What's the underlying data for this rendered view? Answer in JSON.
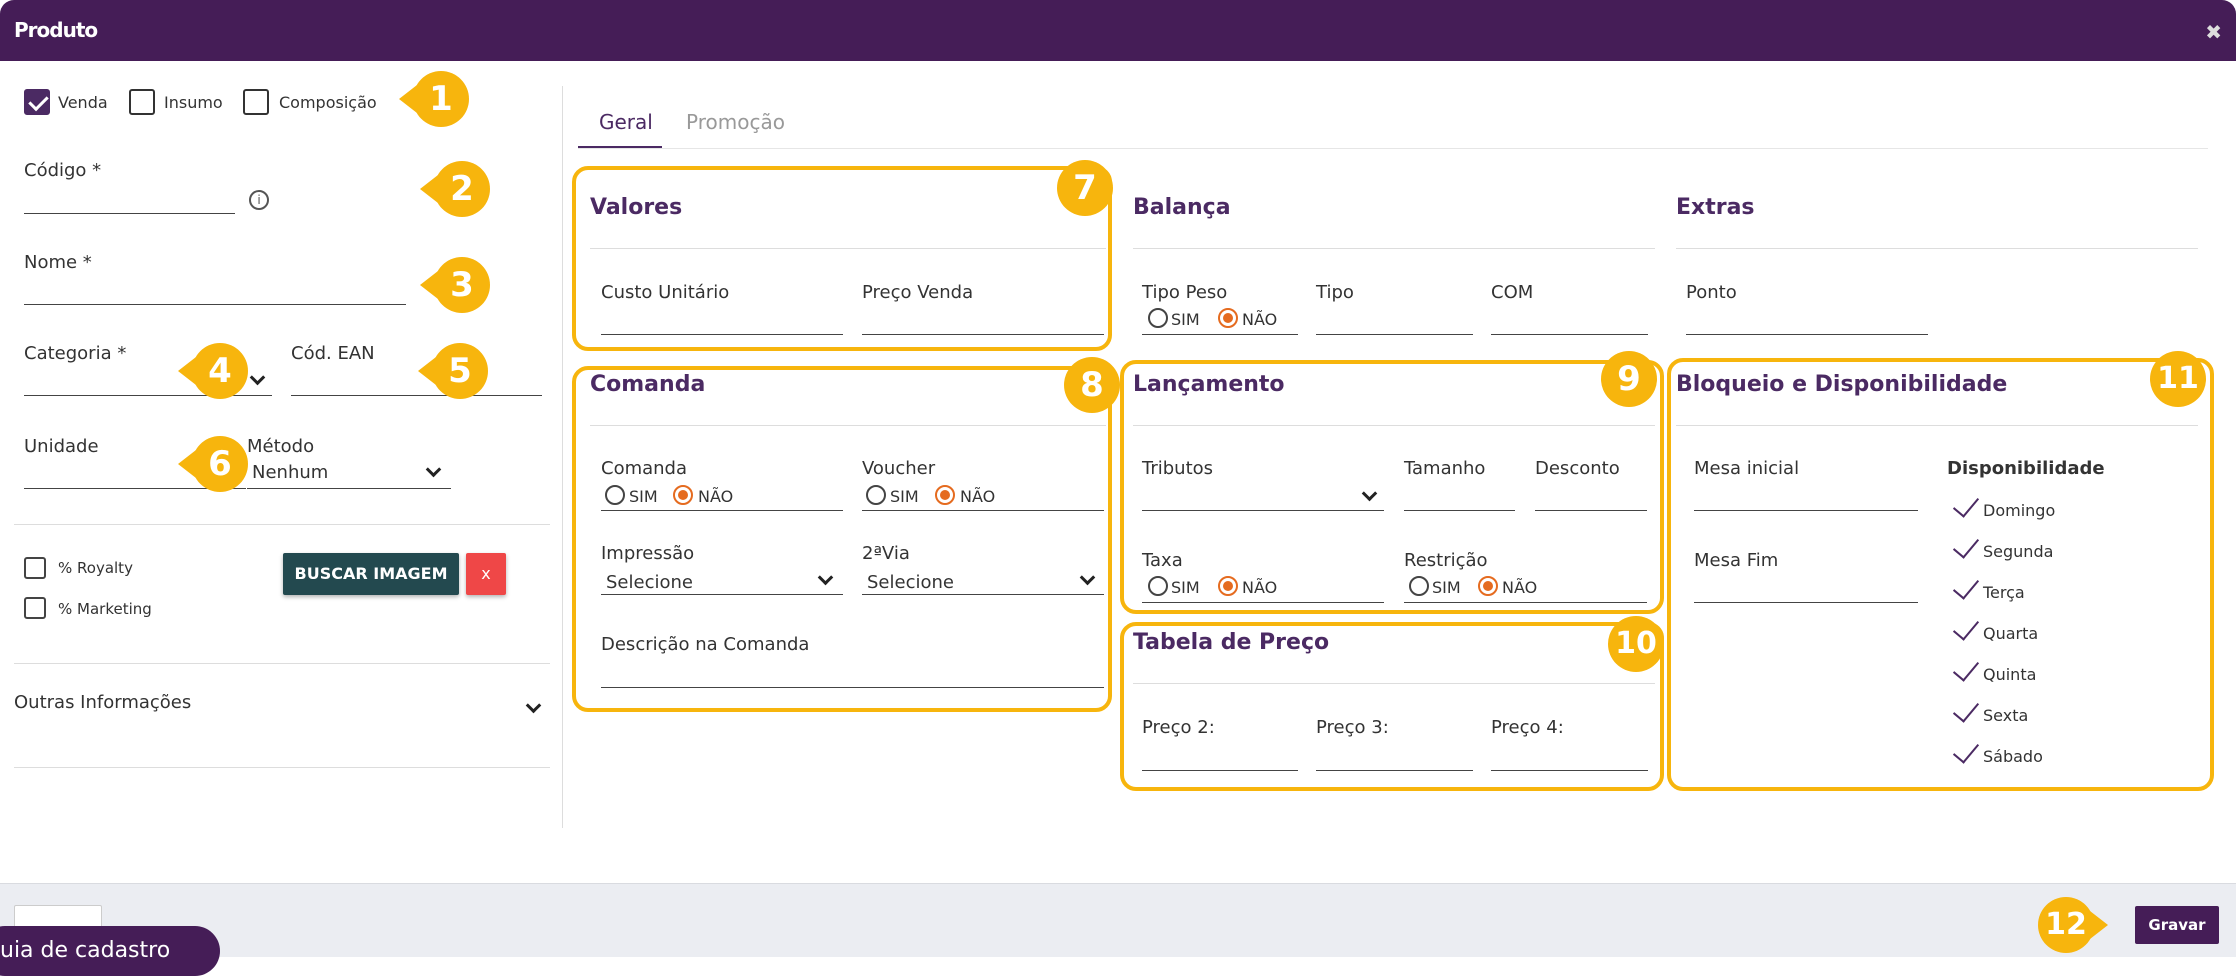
{
  "window": {
    "title": "Produto",
    "close_icon": "close-icon"
  },
  "left": {
    "types": [
      {
        "label": "Venda",
        "checked": true
      },
      {
        "label": "Insumo",
        "checked": false
      },
      {
        "label": "Composição",
        "checked": false
      }
    ],
    "codigo_label": "Código *",
    "nome_label": "Nome *",
    "categoria_label": "Categoria *",
    "ean_label": "Cód. EAN",
    "unidade_label": "Unidade",
    "metodo_label": "Método",
    "metodo_value": "Nenhum",
    "royalty_label": "% Royalty",
    "marketing_label": "% Marketing",
    "buscar_imagem": "BUSCAR IMAGEM",
    "remove_image": "x",
    "outras_info": "Outras Informações"
  },
  "tabs": [
    {
      "label": "Geral",
      "active": true
    },
    {
      "label": "Promoção",
      "active": false
    }
  ],
  "valores": {
    "title": "Valores",
    "custo": "Custo Unitário",
    "preco_venda": "Preço Venda"
  },
  "balanca": {
    "title": "Balança",
    "tipo_peso": "Tipo Peso",
    "tipo": "Tipo",
    "com": "COM"
  },
  "extras": {
    "title": "Extras",
    "ponto": "Ponto"
  },
  "comanda": {
    "title": "Comanda",
    "comanda_label": "Comanda",
    "voucher_label": "Voucher",
    "impressao_label": "Impressão",
    "impressao_value": "Selecione",
    "segunda_via_label": "2ªVia",
    "segunda_via_value": "Selecione",
    "descricao_label": "Descrição na Comanda"
  },
  "lancamento": {
    "title": "Lançamento",
    "tributos": "Tributos",
    "tamanho": "Tamanho",
    "desconto": "Desconto",
    "taxa": "Taxa",
    "restricao": "Restrição"
  },
  "tabela": {
    "title": "Tabela de Preço",
    "preco2": "Preço 2:",
    "preco3": "Preço 3:",
    "preco4": "Preço 4:"
  },
  "bloqueio": {
    "title": "Bloqueio e Disponibilidade",
    "mesa_inicial": "Mesa inicial",
    "mesa_fim": "Mesa Fim",
    "disponibilidade": "Disponibilidade",
    "days": [
      "Domingo",
      "Segunda",
      "Terça",
      "Quarta",
      "Quinta",
      "Sexta",
      "Sábado"
    ]
  },
  "radio": {
    "sim": "SIM",
    "nao": "NÃO"
  },
  "badges": [
    "1",
    "2",
    "3",
    "4",
    "5",
    "6",
    "7",
    "8",
    "9",
    "10",
    "11",
    "12"
  ],
  "footer": {
    "save": "Gravar",
    "guide": "uia de cadastro"
  },
  "colors": {
    "primary": "#451d57",
    "highlight": "#f7b50d",
    "radio_on": "#e56b1f",
    "danger": "#ef4747",
    "dark_button": "#23494f"
  }
}
